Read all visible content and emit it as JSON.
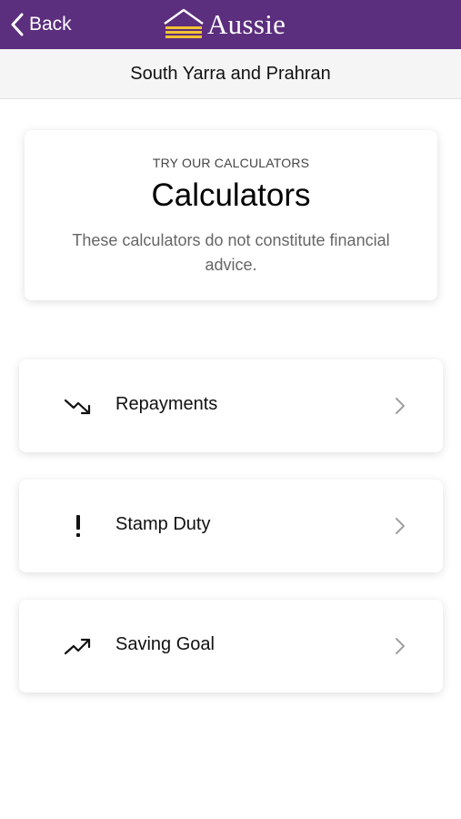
{
  "navbar": {
    "back_label": "Back",
    "brand_name": "Aussie",
    "background_color": "#5b2e7e",
    "logo_accent_color": "#f2c232"
  },
  "subheader": {
    "title": "South Yarra and Prahran"
  },
  "intro": {
    "eyebrow": "TRY OUR CALCULATORS",
    "title": "Calculators",
    "description": "These calculators do not constitute financial advice."
  },
  "calculators": [
    {
      "label": "Repayments",
      "icon": "trending-down-icon"
    },
    {
      "label": "Stamp Duty",
      "icon": "exclamation-icon"
    },
    {
      "label": "Saving Goal",
      "icon": "trending-up-icon"
    }
  ]
}
